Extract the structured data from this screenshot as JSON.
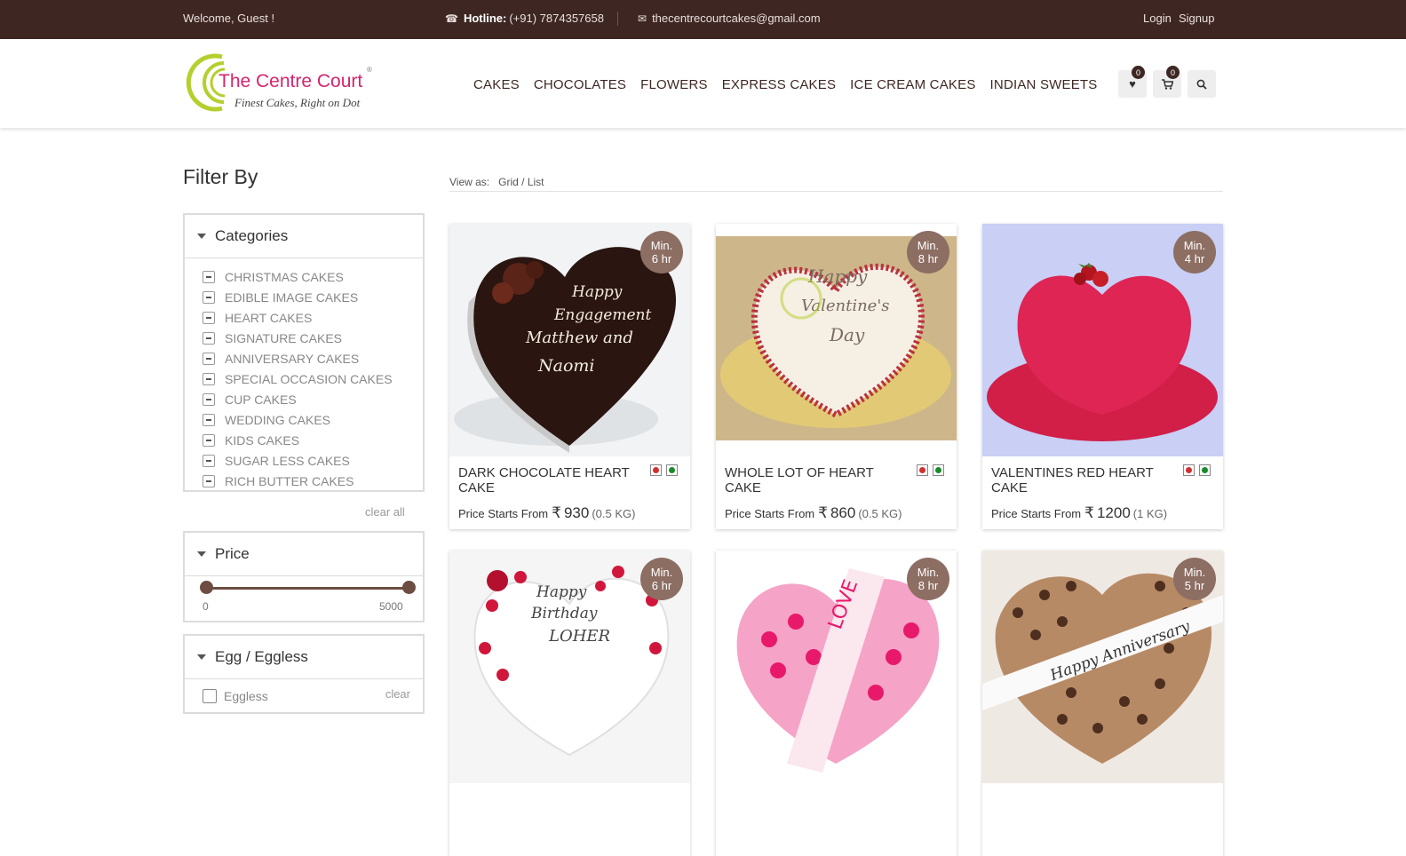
{
  "topbar": {
    "welcome": "Welcome, Guest !",
    "hotline_label": "Hotline:",
    "hotline_number": "(+91) 7874357658",
    "email": "thecentrecourtcakes@gmail.com",
    "login": "Login",
    "signup": "Signup"
  },
  "header": {
    "brand": "The Centre Court",
    "tagline": "Finest Cakes, Right on Dot",
    "nav": [
      "CAKES",
      "CHOCOLATES",
      "FLOWERS",
      "EXPRESS CAKES",
      "ICE CREAM CAKES",
      "INDIAN SWEETS"
    ],
    "wishlist_count": "0",
    "cart_count": "0"
  },
  "sidebar": {
    "title": "Filter By",
    "categories": {
      "heading": "Categories",
      "items": [
        "CHRISTMAS CAKES",
        "EDIBLE IMAGE CAKES",
        "HEART CAKES",
        "SIGNATURE CAKES",
        "ANNIVERSARY CAKES",
        "SPECIAL OCCASION CAKES",
        "CUP CAKES",
        "WEDDING CAKES",
        "KIDS CAKES",
        "SUGAR LESS CAKES",
        "RICH BUTTER CAKES"
      ],
      "clear_all": "clear all"
    },
    "price": {
      "heading": "Price",
      "min": "0",
      "max": "5000"
    },
    "egg": {
      "heading": "Egg / Eggless",
      "option": "Eggless",
      "clear": "clear"
    }
  },
  "viewas": {
    "label": "View as:",
    "options": "Grid / List"
  },
  "products": [
    {
      "name": "DARK CHOCOLATE HEART CAKE",
      "min_line1": "Min.",
      "min_line2": "6 hr",
      "price_label": "Price Starts From",
      "currency": "₹",
      "price": "930",
      "weight": "(0.5 KG)"
    },
    {
      "name": "WHOLE LOT OF HEART CAKE",
      "min_line1": "Min.",
      "min_line2": "8 hr",
      "price_label": "Price Starts From",
      "currency": "₹",
      "price": "860",
      "weight": "(0.5 KG)"
    },
    {
      "name": "VALENTINES RED HEART CAKE",
      "min_line1": "Min.",
      "min_line2": "4 hr",
      "price_label": "Price Starts From",
      "currency": "₹",
      "price": "1200",
      "weight": "(1 KG)"
    },
    {
      "min_line1": "Min.",
      "min_line2": "6 hr"
    },
    {
      "min_line1": "Min.",
      "min_line2": "8 hr"
    },
    {
      "min_line1": "Min.",
      "min_line2": "5 hr"
    }
  ],
  "colors": {
    "topbar": "#3e2723",
    "brand_pink": "#d6246e",
    "badge_brown": "#8d6e63",
    "veg_red": "#d32f2f",
    "veg_green": "#1b8a2a"
  }
}
